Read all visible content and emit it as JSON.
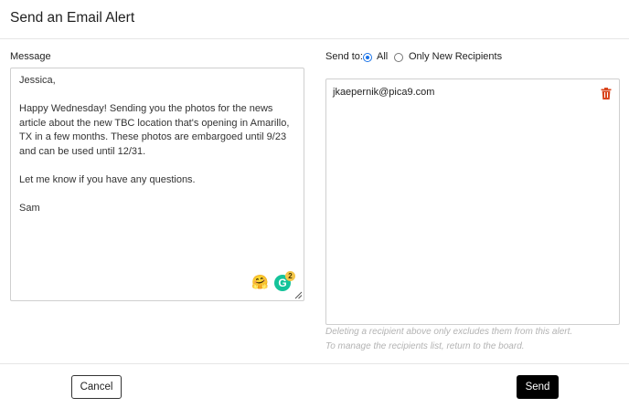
{
  "dialog": {
    "title": "Send an Email Alert"
  },
  "message": {
    "label": "Message",
    "text": "Jessica,\n\nHappy Wednesday! Sending you the photos for the news article about the new TBC location that's opening in Amarillo, TX in a few months. These photos are embargoed until 9/23 and can be used until 12/31.\n\nLet me know if you have any questions.\n\nSam",
    "emoji_glyph": "🤗",
    "grammarly_glyph": "G",
    "grammarly_count": "2"
  },
  "send_to": {
    "label": "Send to:",
    "options": [
      {
        "label": "All",
        "selected": true
      },
      {
        "label": "Only New Recipients",
        "selected": false
      }
    ]
  },
  "recipients": [
    {
      "email": "jkaepernik@pica9.com"
    }
  ],
  "hint": {
    "line1": "Deleting a recipient above only excludes them from this alert.",
    "line2": "To manage the recipients list, return to the board."
  },
  "buttons": {
    "cancel": "Cancel",
    "send": "Send"
  },
  "colors": {
    "accent": "#1a73e8",
    "trash": "#d9461e",
    "send_bg": "#000000",
    "grammarly": "#15c39a"
  }
}
